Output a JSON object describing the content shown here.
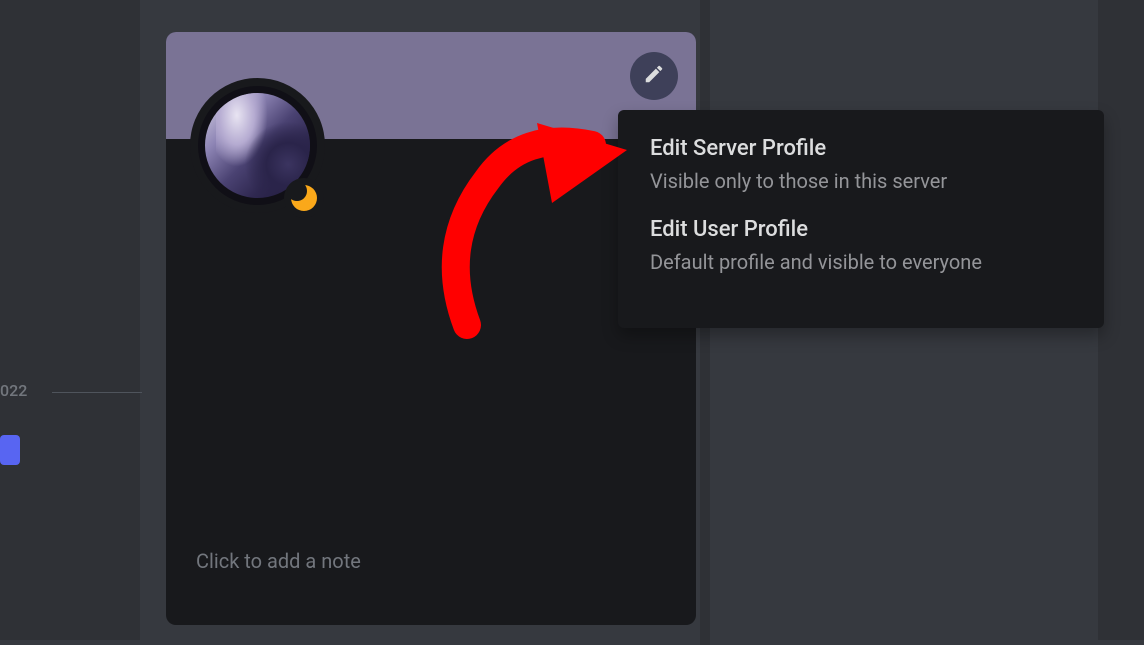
{
  "background": {
    "date_text": "022"
  },
  "profile": {
    "note_placeholder": "Click to add a note",
    "status": "idle"
  },
  "menu": {
    "items": [
      {
        "title": "Edit Server Profile",
        "desc": "Visible only to those in this server"
      },
      {
        "title": "Edit User Profile",
        "desc": "Default profile and visible to everyone"
      }
    ]
  }
}
